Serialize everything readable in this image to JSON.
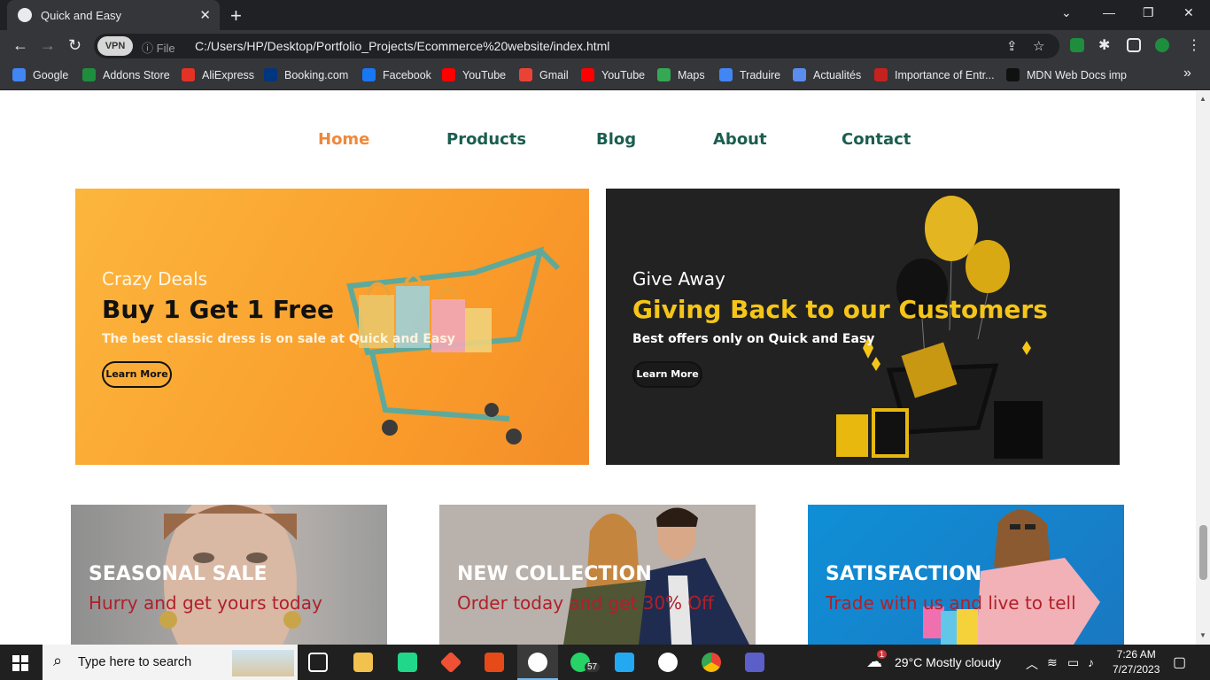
{
  "browser": {
    "tab_title": "Quick and Easy",
    "new_tab": "+",
    "tab_close": "✕",
    "vpn_label": "VPN",
    "file_label": "File",
    "url": "C:/Users/HP/Desktop/Portfolio_Projects/Ecommerce%20website/index.html",
    "bookmarks": [
      {
        "label": "Google",
        "color": "#4285f4"
      },
      {
        "label": "Addons Store",
        "color": "#1e8e3e"
      },
      {
        "label": "AliExpress",
        "color": "#e43225"
      },
      {
        "label": "Booking.com",
        "color": "#003580"
      },
      {
        "label": "Facebook",
        "color": "#1877f2"
      },
      {
        "label": "YouTube",
        "color": "#ff0000"
      },
      {
        "label": "Gmail",
        "color": "#ea4335"
      },
      {
        "label": "YouTube",
        "color": "#ff0000"
      },
      {
        "label": "Maps",
        "color": "#34a853"
      },
      {
        "label": "Traduire",
        "color": "#4285f4"
      },
      {
        "label": "Actualités",
        "color": "#5b8def"
      },
      {
        "label": "Importance of Entr...",
        "color": "#c5221f"
      },
      {
        "label": "MDN Web Docs imp",
        "color": "#111111"
      }
    ],
    "bookmarks_more": "»"
  },
  "nav": {
    "items": [
      "Home",
      "Products",
      "Blog",
      "About",
      "Contact"
    ],
    "active": "Home"
  },
  "banners": [
    {
      "subtitle": "Crazy Deals",
      "title": "Buy 1 Get 1 Free",
      "description": "The best classic dress is on sale at Quick and Easy",
      "button": "Learn More"
    },
    {
      "subtitle": "Give Away",
      "title": "Giving Back to our Customers",
      "description": "Best offers only on Quick and Easy",
      "button": "Learn More"
    }
  ],
  "promos": [
    {
      "title": "SEASONAL SALE",
      "subtitle": "Hurry and get yours today"
    },
    {
      "title": "NEW COLLECTION",
      "subtitle": "Order today and get 30% Off"
    },
    {
      "title": "SATISFACTION",
      "subtitle": "Trade with us and live to tell"
    }
  ],
  "taskbar": {
    "search_placeholder": "Type here to search",
    "whatsapp_badge": "57",
    "weather_badge": "1",
    "weather": "29°C  Mostly cloudy",
    "time": "7:26 AM",
    "date": "7/27/2023"
  },
  "colors": {
    "brand_green": "#1b5e50",
    "active_orange": "#f0883a",
    "gold": "#f5c518",
    "promo_red": "#b0202a"
  }
}
